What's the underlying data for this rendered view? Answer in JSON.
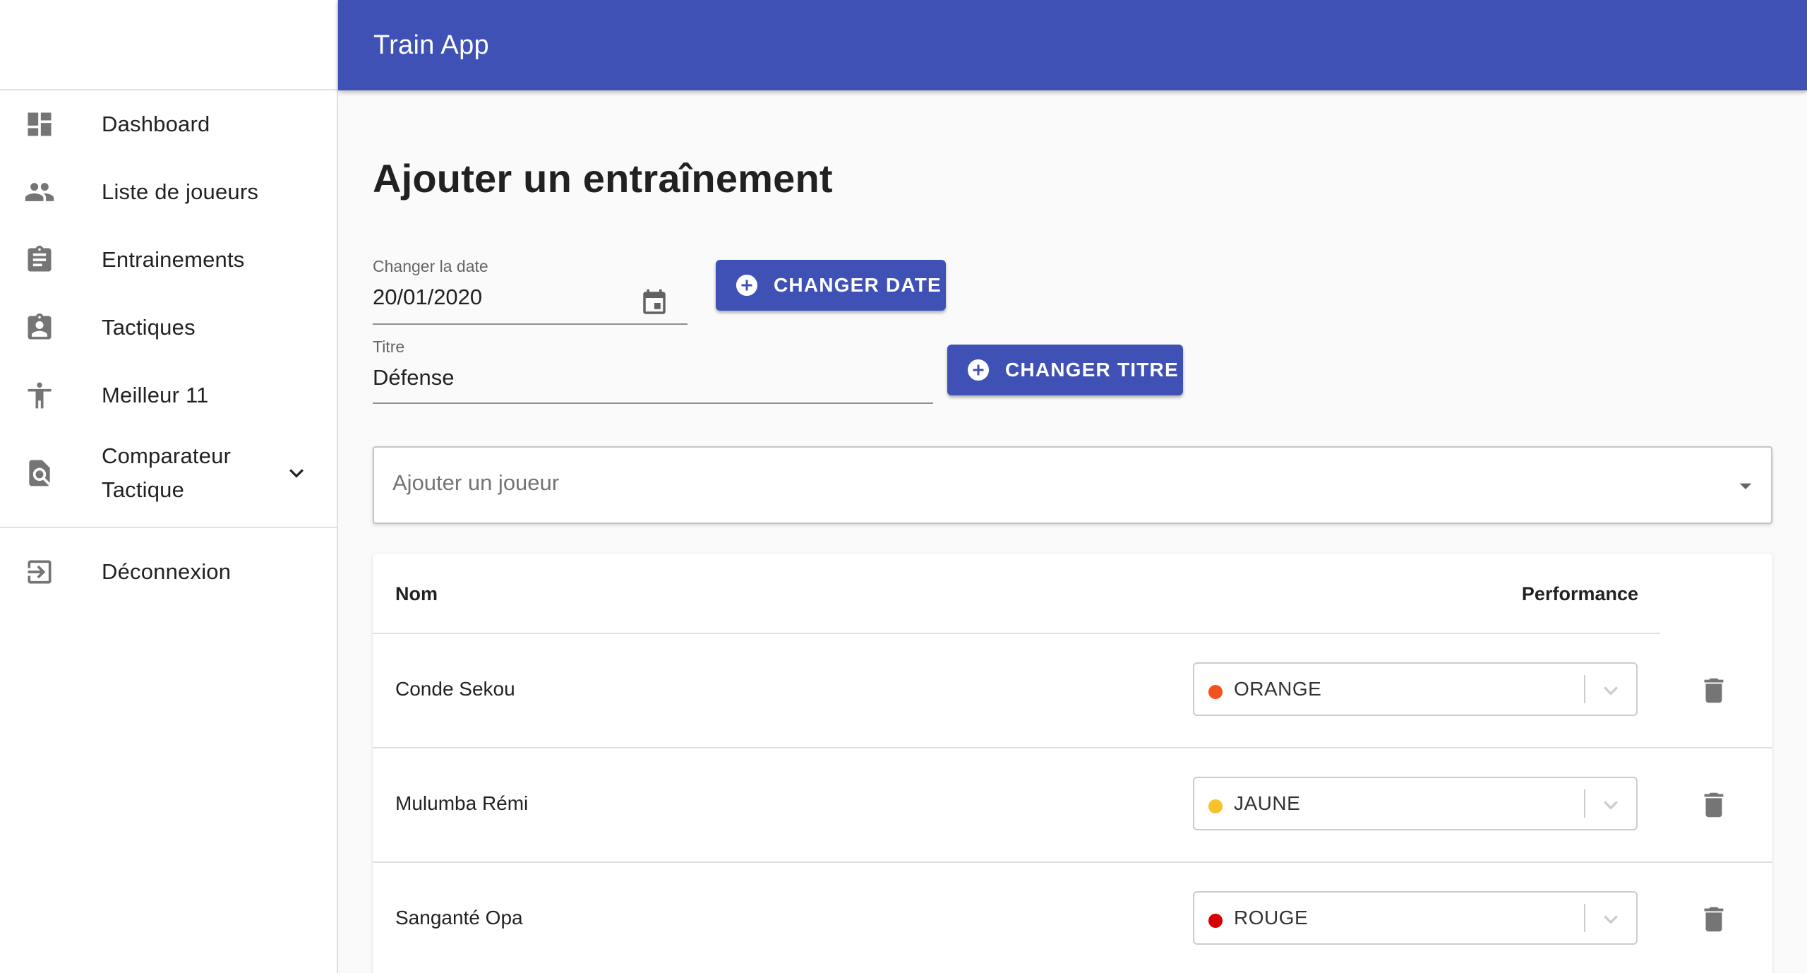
{
  "app": {
    "title": "Train App"
  },
  "sidebar": {
    "items": [
      {
        "label": "Dashboard",
        "icon": "dashboard-icon"
      },
      {
        "label": "Liste de joueurs",
        "icon": "people-icon"
      },
      {
        "label": "Entrainements",
        "icon": "clipboard-icon"
      },
      {
        "label": "Tactiques",
        "icon": "assignment-ind-icon"
      },
      {
        "label": "Meilleur 11",
        "icon": "accessibility-icon"
      },
      {
        "label": "Comparateur Tactique",
        "icon": "find-in-page-icon"
      }
    ],
    "logout": {
      "label": "Déconnexion",
      "icon": "exit-icon"
    }
  },
  "page": {
    "title": "Ajouter un entraînement"
  },
  "date_field": {
    "label": "Changer la date",
    "value": "20/01/2020"
  },
  "title_field": {
    "label": "Titre",
    "value": "Défense"
  },
  "buttons": {
    "change_date": "CHANGER DATE",
    "change_title": "CHANGER TITRE"
  },
  "player_select": {
    "placeholder": "Ajouter un joueur"
  },
  "table": {
    "headers": {
      "name": "Nom",
      "performance": "Performance"
    },
    "rows": [
      {
        "name": "Conde Sekou",
        "performance": "ORANGE",
        "color": "#f4511e"
      },
      {
        "name": "Mulumba Rémi",
        "performance": "JAUNE",
        "color": "#fbc02d"
      },
      {
        "name": "Sanganté Opa",
        "performance": "ROUGE",
        "color": "#d50000"
      }
    ]
  },
  "colors": {
    "primary": "#3f51b5",
    "background": "#fafafa"
  }
}
